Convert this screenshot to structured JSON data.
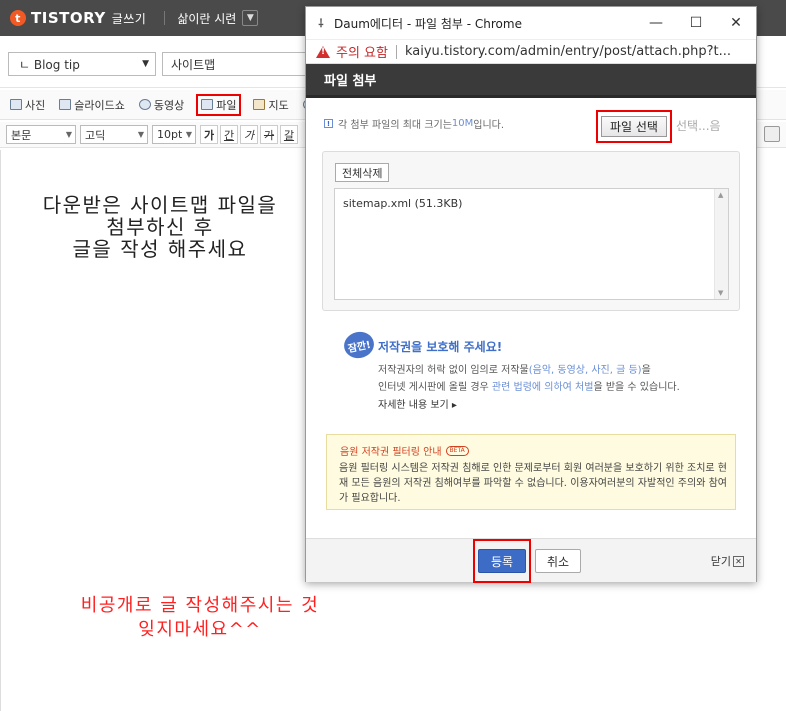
{
  "editor": {
    "logo": "TISTORY",
    "logo_sub": "글쓰기",
    "blog_name": "삶이란 시련",
    "category": "ㄴ Blog tip",
    "post_title": "사이트맵",
    "toolbar": [
      {
        "label": "사진",
        "icon": "photo-icon"
      },
      {
        "label": "슬라이드쇼",
        "icon": "slideshow-icon"
      },
      {
        "label": "동영상",
        "icon": "video-icon"
      },
      {
        "label": "파일",
        "icon": "file-icon"
      },
      {
        "label": "지도",
        "icon": "map-icon"
      }
    ],
    "format": {
      "style": "본문",
      "font": "고딕",
      "size": "10pt",
      "buttons": [
        "가",
        "간",
        "가",
        "가",
        "갈"
      ]
    },
    "body_text_1": [
      "다운받은 사이트맵 파일을",
      "첨부하신 후",
      "글을 작성 해주세요"
    ],
    "body_text_2": [
      "비공개로 글 작성해주시는 것",
      "잊지마세요^^"
    ],
    "accent_red": "#ff2020"
  },
  "popup": {
    "window_title": "Daum에디터 - 파일 첨부 - Chrome",
    "warning": "주의 요함",
    "url": "kaiyu.tistory.com/admin/entry/post/attach.php?t...",
    "header": "파일 첨부",
    "max_size_note": {
      "before": "각 첨부 파일의 최대 크기는 ",
      "value": "10M",
      "after": " 입니다."
    },
    "file_select": "파일 선택",
    "file_select_rest": "선택...음",
    "delete_all": "전체삭제",
    "files": [
      "sitemap.xml (51.3KB)"
    ],
    "copyright": {
      "badge": "잠깐!",
      "title": "저작권을 보호해 주세요!",
      "line1_a": "저작권자의 허락 없이 임의로 저작물",
      "line1_link": "(음악, 동영상, 사진, 글 등)",
      "line1_b": "을",
      "line2_a": "인터넷 게시판에 올릴 경우 ",
      "line2_link": "관련 법령에 의하여 처벌",
      "line2_b": "을 받을 수 있습니다.",
      "more": "자세한 내용 보기 ▸"
    },
    "notice": {
      "title": "음원 저작권 필터링 안내",
      "beta": "BETA",
      "body": "음원 필터링 시스템은 저작권 침해로 인한 문제로부터 회원 여러분을 보호하기 위한 조치로 현재 모든 음원의 저작권 침해여부를 파악할 수 없습니다. 이용자여러분의 자발적인 주의와 참여가 필요합니다."
    },
    "ok": "등록",
    "cancel": "취소",
    "close": "닫기",
    "accent_blue": "#3d6cc6",
    "highlight_red": "#e00000"
  }
}
